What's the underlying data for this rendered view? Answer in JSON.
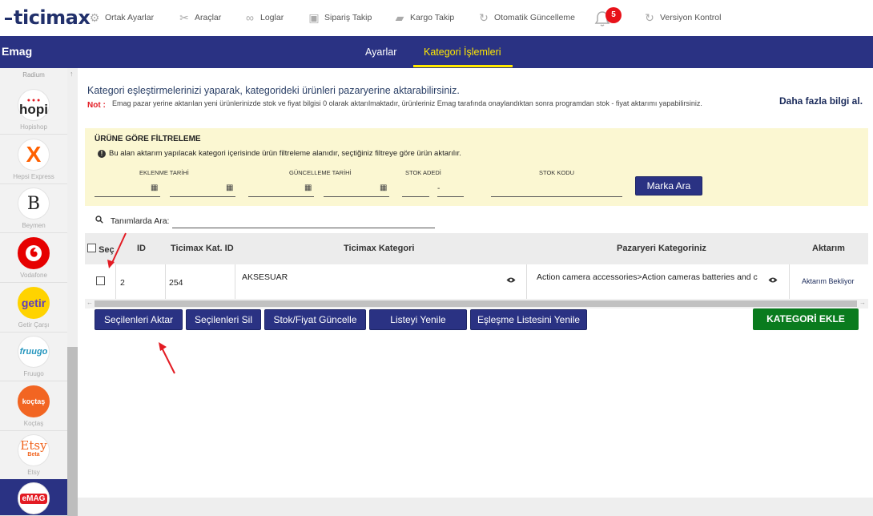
{
  "app": {
    "logo": "ticimax",
    "module_title": "Emag"
  },
  "topnav": [
    {
      "label": "Ortak Ayarlar",
      "icon": "gear-icon"
    },
    {
      "label": "Araçlar",
      "icon": "tools-icon"
    },
    {
      "label": "Loglar",
      "icon": "glasses-icon"
    },
    {
      "label": "Sipariş Takip",
      "icon": "box-icon"
    },
    {
      "label": "Kargo Takip",
      "icon": "truck-icon"
    },
    {
      "label": "Otomatik Güncelleme",
      "icon": "refresh-icon"
    },
    {
      "label": "Versiyon Kontrol",
      "icon": "sync-icon"
    }
  ],
  "notifications": {
    "count": "5",
    "icon": "bell-icon"
  },
  "tabs": [
    {
      "label": "Ayarlar",
      "active": false
    },
    {
      "label": "Kategori İşlemleri",
      "active": true
    }
  ],
  "sidebar": {
    "top_label": "Radium",
    "items": [
      {
        "label": "Hopishop",
        "logo_text": "hopi"
      },
      {
        "label": "Hepsi Express",
        "logo_text": "X"
      },
      {
        "label": "Beymen",
        "logo_text": "B"
      },
      {
        "label": "Vodafone",
        "logo_text": ""
      },
      {
        "label": "Getir Çarşı",
        "logo_text": "getir"
      },
      {
        "label": "Fruugo",
        "logo_text": "fruugo"
      },
      {
        "label": "Koçtaş",
        "logo_text": "koçtaş"
      },
      {
        "label": "Etsy",
        "logo_text": "Etsy",
        "sub_text": "Beta"
      },
      {
        "label": "",
        "logo_text": "eMAG",
        "active": true
      }
    ]
  },
  "main": {
    "intro": "Kategori eşleştirmelerinizi yaparak, kategorideki ürünleri pazaryerine aktarabilirsiniz.",
    "note_label": "Not :",
    "note_text": "Emag pazar yerine aktarılan yeni ürünlerinizde stok ve fiyat bilgisi 0 olarak aktarılmaktadır, ürünleriniz Emag tarafında onaylandıktan sonra programdan stok - fiyat aktarımı yapabilirsiniz.",
    "more_info": "Daha fazla bilgi al."
  },
  "filter": {
    "title": "ÜRÜNE GÖRE FİLTRELEME",
    "info": "Bu alan aktarım yapılacak kategori içerisinde ürün filtreleme alanıdır, seçtiğiniz filtreye göre ürün aktarılır.",
    "labels": {
      "added_date": "EKLENME TARİHİ",
      "updated_date": "GÜNCELLEME TARİHİ",
      "stock_count": "STOK ADEDİ",
      "stock_code": "STOK KODU"
    },
    "button": "Marka Ara"
  },
  "search": {
    "label": "Tanımlarda Ara:",
    "value": ""
  },
  "table": {
    "headers": {
      "select": "Seç",
      "id": "ID",
      "ticimax_cat_id": "Ticimax Kat. ID",
      "ticimax_category": "Ticimax Kategori",
      "marketplace_category": "Pazaryeri Kategoriniz",
      "transfer": "Aktarım"
    },
    "rows": [
      {
        "id": "2",
        "ticimax_cat_id": "254",
        "ticimax_category": "AKSESUAR",
        "marketplace_category": "Action camera accessories>Action cameras batteries and c",
        "transfer": "Aktarım Bekliyor"
      }
    ]
  },
  "actions": {
    "transfer_selected": "Seçilenleri Aktar",
    "delete_selected": "Seçilenleri Sil",
    "update_stock_price": "Stok/Fiyat Güncelle",
    "refresh_list": "Listeyi Yenile",
    "refresh_matching_list": "Eşleşme Listesini Yenile",
    "add_category": "KATEGORİ EKLE"
  },
  "colors": {
    "brand_blue": "#2a3283",
    "active_tab": "#ffe800",
    "filter_bg": "#fbf7d2",
    "add_button": "#0a7b1e",
    "badge": "#e8121a",
    "annotation_arrow": "#e31b23"
  }
}
